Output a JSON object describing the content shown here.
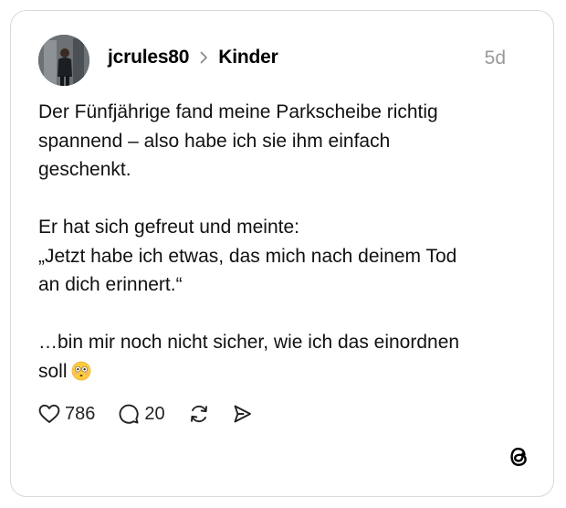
{
  "post": {
    "username": "jcrules80",
    "community": "Kinder",
    "time_ago": "5d",
    "paragraphs": [
      [
        "Der Fünfjährige fand meine Parkscheibe richtig",
        "spannend – also habe ich sie ihm einfach",
        "geschenkt."
      ],
      [
        "Er hat sich gefreut und meinte:",
        "„Jetzt habe ich etwas, das mich nach deinem Tod",
        "an dich erinnert.“"
      ],
      [
        "…bin mir noch nicht sicher, wie ich das einordnen",
        "soll"
      ]
    ],
    "emoji": "flushed-face-emoji"
  },
  "actions": {
    "likes": "786",
    "replies": "20",
    "icons": [
      "heart-icon",
      "comment-icon",
      "repost-icon",
      "share-icon"
    ]
  },
  "branding": {
    "icon": "threads-logo-icon"
  },
  "colors": {
    "border": "#d9d9d9",
    "muted": "#9a9a9a",
    "text": "#111111"
  }
}
